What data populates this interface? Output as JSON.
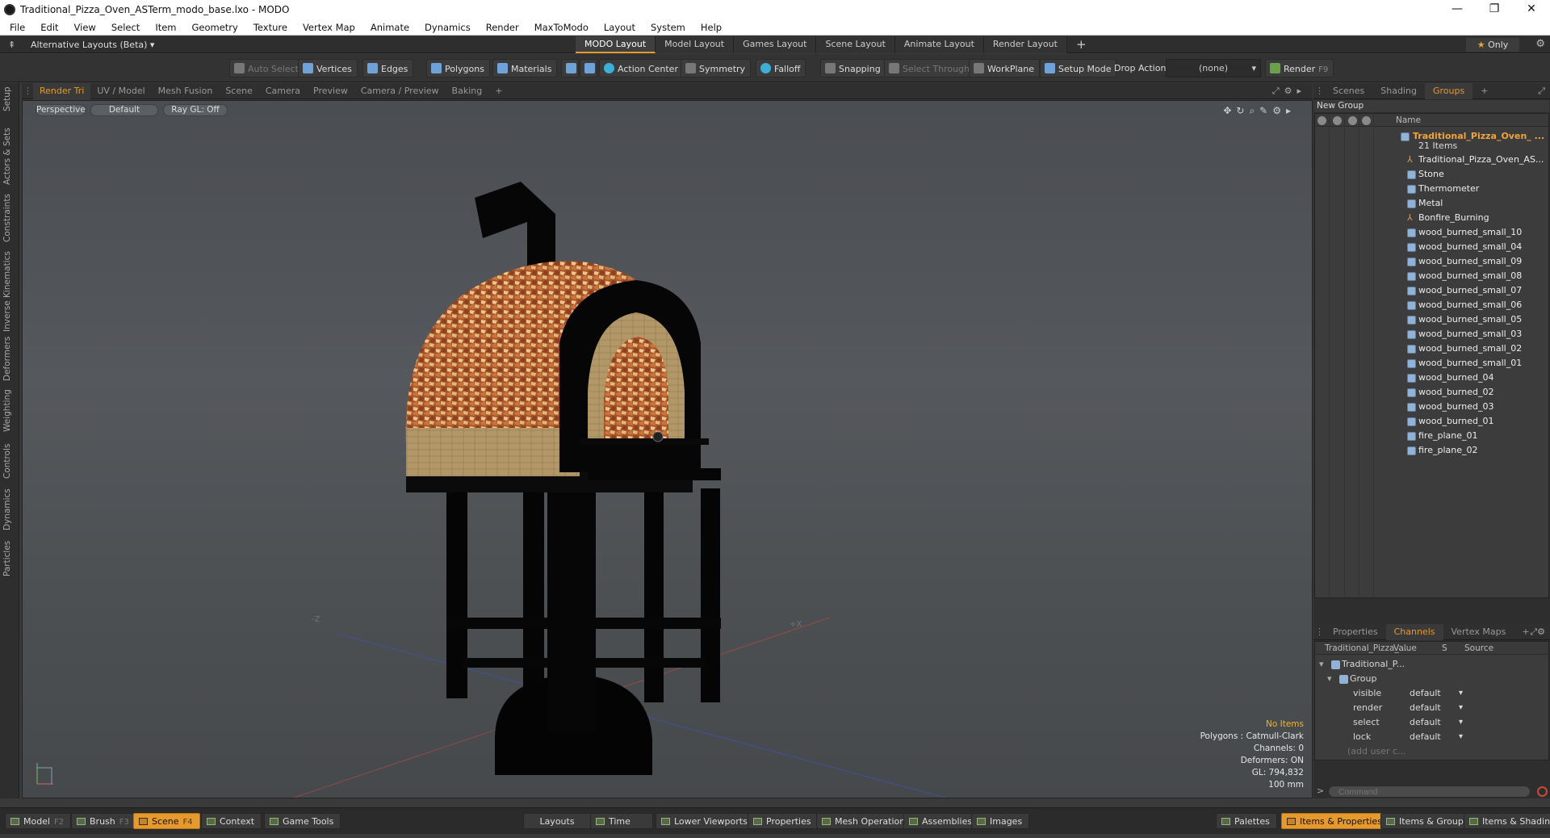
{
  "window": {
    "title": "Traditional_Pizza_Oven_ASTerm_modo_base.lxo - MODO",
    "min_glyph": "—",
    "max_glyph": "❐",
    "close_glyph": "✕"
  },
  "menu": [
    "File",
    "Edit",
    "View",
    "Select",
    "Item",
    "Geometry",
    "Texture",
    "Vertex Map",
    "Animate",
    "Dynamics",
    "Render",
    "MaxToModo",
    "Layout",
    "System",
    "Help"
  ],
  "layoutbar": {
    "alt_layouts": "Alternative Layouts (Beta) ▾",
    "tabs": [
      "MODO Layout",
      "Model Layout",
      "Games Layout",
      "Scene Layout",
      "Animate Layout",
      "Render Layout"
    ],
    "active_tab": "MODO Layout",
    "plus": "+",
    "only": "Only",
    "only_star": "★"
  },
  "toolbar": {
    "auto_select": "Auto Select",
    "vertices": "Vertices",
    "edges": "Edges",
    "polygons": "Polygons",
    "materials": "Materials",
    "action_center": "Action Center",
    "symmetry": "Symmetry",
    "falloff": "Falloff",
    "snapping": "Snapping",
    "select_through": "Select Through",
    "workplane": "WorkPlane",
    "setup_mode": "Setup Mode",
    "drop_action": "Drop Action",
    "drop_value": "(none)",
    "render": "Render",
    "render_key": "F9"
  },
  "left_tabs": [
    "Setup",
    "Actors & Sets",
    "Constraints",
    "Inverse Kinematics",
    "Deformers",
    "Weighting",
    "Controls",
    "Dynamics",
    "Particles"
  ],
  "viewport_tabs": [
    "Render Tri",
    "UV / Model",
    "Mesh Fusion",
    "Scene",
    "Camera",
    "Preview",
    "Camera / Preview",
    "Baking",
    "+"
  ],
  "viewport": {
    "perspective": "Perspective",
    "shading": "Default",
    "raygl": "Ray GL: Off",
    "axis_neg_z": "-Z",
    "axis_pos_x": "+X",
    "info": {
      "items": "No Items",
      "polygons": "Polygons : Catmull-Clark",
      "channels": "Channels: 0",
      "deformers": "Deformers: ON",
      "gl": "GL: 794,832",
      "scale": "100 mm"
    }
  },
  "right_tabs": [
    "Scenes",
    "Shading",
    "Groups",
    "+"
  ],
  "groups": {
    "new_group": "New Group",
    "col_name": "Name",
    "root": "Traditional_Pizza_Oven_ ...",
    "count": "21 Items",
    "items": [
      {
        "name": "Traditional_Pizza_Oven_AS...",
        "icon": "locator-icon"
      },
      {
        "name": "Stone",
        "icon": "mesh-icon"
      },
      {
        "name": "Thermometer",
        "icon": "mesh-icon"
      },
      {
        "name": "Metal",
        "icon": "mesh-icon"
      },
      {
        "name": "Bonfire_Burning",
        "icon": "locator-icon"
      },
      {
        "name": "wood_burned_small_10",
        "icon": "mesh-icon"
      },
      {
        "name": "wood_burned_small_04",
        "icon": "mesh-icon"
      },
      {
        "name": "wood_burned_small_09",
        "icon": "mesh-icon"
      },
      {
        "name": "wood_burned_small_08",
        "icon": "mesh-icon"
      },
      {
        "name": "wood_burned_small_07",
        "icon": "mesh-icon"
      },
      {
        "name": "wood_burned_small_06",
        "icon": "mesh-icon"
      },
      {
        "name": "wood_burned_small_05",
        "icon": "mesh-icon"
      },
      {
        "name": "wood_burned_small_03",
        "icon": "mesh-icon"
      },
      {
        "name": "wood_burned_small_02",
        "icon": "mesh-icon"
      },
      {
        "name": "wood_burned_small_01",
        "icon": "mesh-icon"
      },
      {
        "name": "wood_burned_04",
        "icon": "mesh-icon"
      },
      {
        "name": "wood_burned_02",
        "icon": "mesh-icon"
      },
      {
        "name": "wood_burned_03",
        "icon": "mesh-icon"
      },
      {
        "name": "wood_burned_01",
        "icon": "mesh-icon"
      },
      {
        "name": "fire_plane_01",
        "icon": "mesh-icon"
      },
      {
        "name": "fire_plane_02",
        "icon": "mesh-icon"
      }
    ]
  },
  "channel_tabs": [
    "Properties",
    "Channels",
    "Vertex Maps",
    "+"
  ],
  "channels": {
    "col_item": "Traditional_Pizza_...",
    "col_value": "Value",
    "col_s": "S",
    "col_source": "Source",
    "tree_root": "Traditional_P...",
    "tree_group": "Group",
    "rows": [
      {
        "key": "visible",
        "value": "default"
      },
      {
        "key": "render",
        "value": "default"
      },
      {
        "key": "select",
        "value": "default"
      },
      {
        "key": "lock",
        "value": "default"
      }
    ],
    "add_user": "(add user c..."
  },
  "command": {
    "placeholder": "Command"
  },
  "statusbar": {
    "model": "Model",
    "model_key": "F2",
    "brush": "Brush",
    "brush_key": "F3",
    "scene": "Scene",
    "scene_key": "F4",
    "context": "Context",
    "game_tools": "Game Tools",
    "layouts": "Layouts",
    "time": "Time",
    "lower_viewports": "Lower Viewports",
    "properties": "Properties",
    "mesh_operations": "Mesh Operations",
    "assemblies": "Assemblies",
    "images": "Images",
    "palettes": "Palettes",
    "items_properties": "Items & Properties",
    "items_groups": "Items & Groups",
    "items_shading": "Items & Shading"
  },
  "colors": {
    "accent": "#e59a2b",
    "root_item": "#f0a43a",
    "viewport_top": "#4a4d52"
  }
}
